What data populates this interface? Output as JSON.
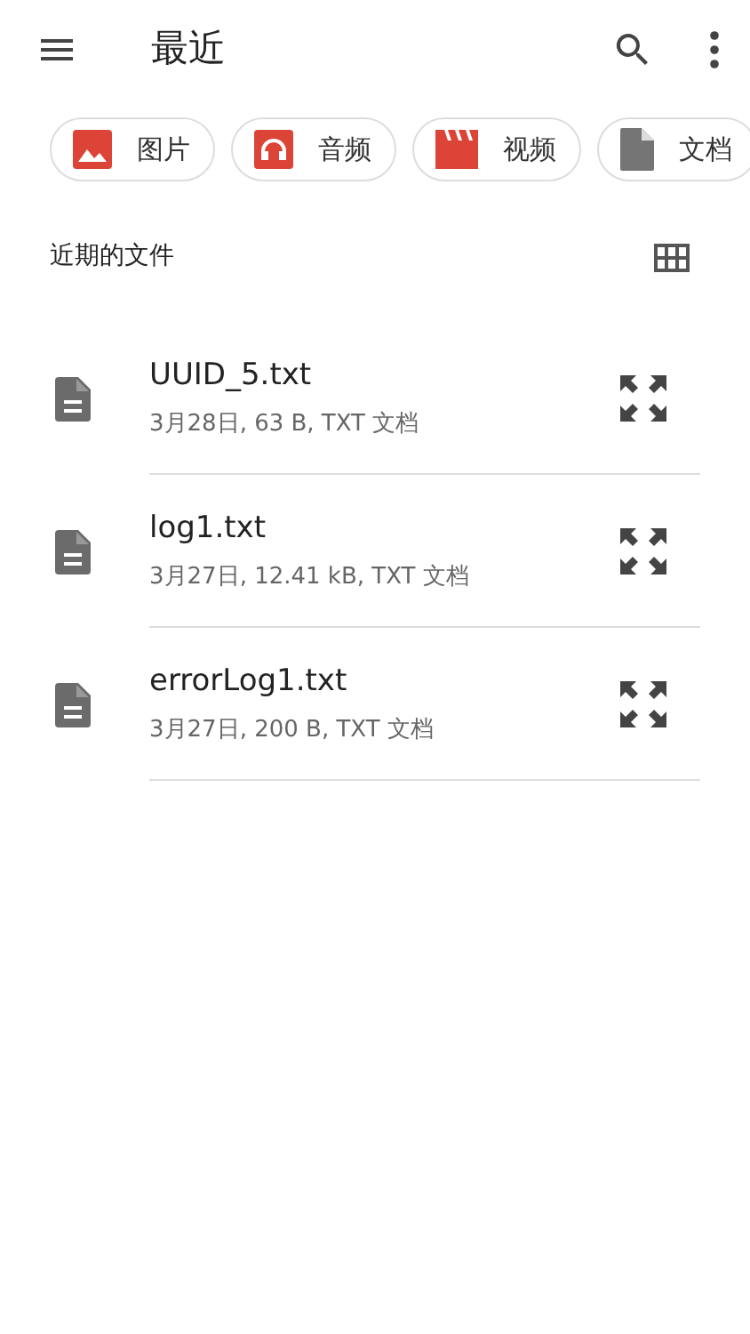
{
  "app_bar": {
    "title": "最近"
  },
  "chips": [
    {
      "kind": "image",
      "label": "图片"
    },
    {
      "kind": "audio",
      "label": "音频"
    },
    {
      "kind": "video",
      "label": "视频"
    },
    {
      "kind": "document",
      "label": "文档"
    }
  ],
  "section": {
    "title": "近期的文件"
  },
  "files": [
    {
      "name": "UUID_5.txt",
      "details": "3月28日, 63 B, TXT 文档"
    },
    {
      "name": "log1.txt",
      "details": "3月27日, 12.41 kB, TXT 文档"
    },
    {
      "name": "errorLog1.txt",
      "details": "3月27日, 200 B, TXT 文档"
    }
  ]
}
